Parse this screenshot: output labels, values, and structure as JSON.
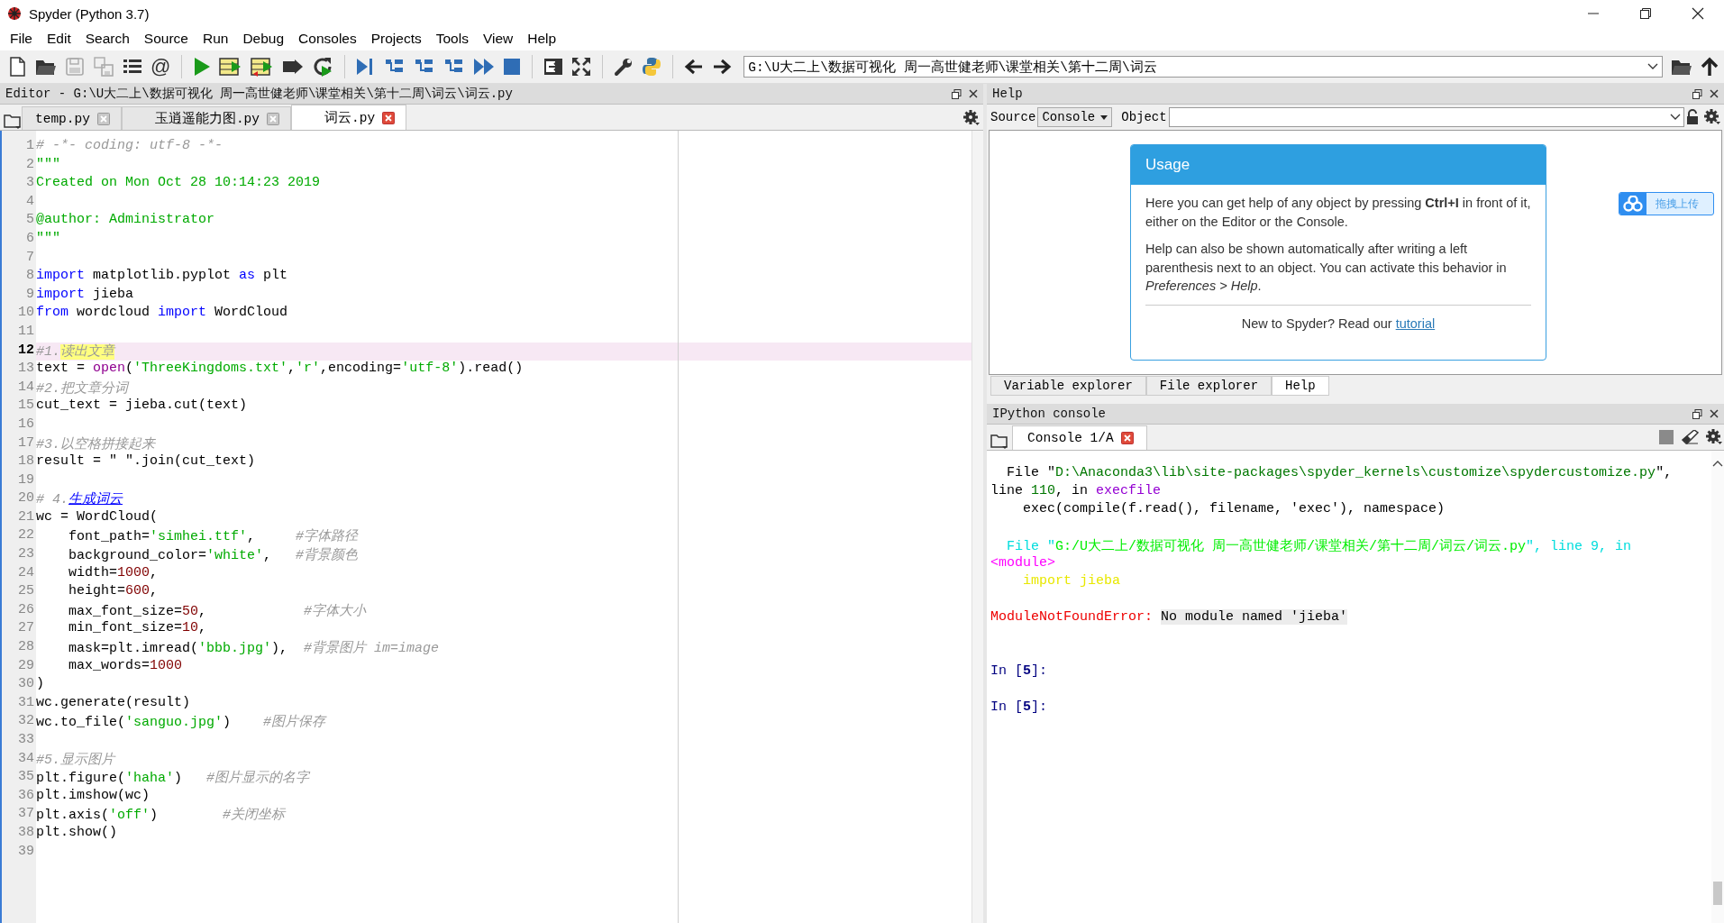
{
  "window": {
    "title": "Spyder (Python 3.7)"
  },
  "menu": [
    {
      "label": "File"
    },
    {
      "label": "Edit"
    },
    {
      "label": "Search"
    },
    {
      "label": "Source"
    },
    {
      "label": "Run"
    },
    {
      "label": "Debug"
    },
    {
      "label": "Consoles"
    },
    {
      "label": "Projects"
    },
    {
      "label": "Tools"
    },
    {
      "label": "View"
    },
    {
      "label": "Help"
    }
  ],
  "toolbar": {
    "at_symbol": "@",
    "path": "G:\\U大二上\\数据可视化 周一高世健老师\\课堂相关\\第十二周\\词云"
  },
  "editor": {
    "title": "Editor - G:\\U大二上\\数据可视化 周一高世健老师\\课堂相关\\第十二周\\词云\\词云.py",
    "tabs": [
      {
        "label": "temp.py",
        "selected": false
      },
      {
        "label": "玉逍遥能力图.py",
        "selected": false
      },
      {
        "label": "词云.py",
        "selected": true
      }
    ],
    "lines": [
      {
        "number": "1",
        "current": false,
        "tokens": [
          {
            "kind": "comment",
            "text": "# -*- coding: utf-8 -*-"
          }
        ]
      },
      {
        "number": "2",
        "current": false,
        "tokens": [
          {
            "kind": "doc",
            "text": "\"\"\""
          }
        ]
      },
      {
        "number": "3",
        "current": false,
        "tokens": [
          {
            "kind": "doc",
            "text": "Created on Mon Oct 28 10:14:23 2019"
          }
        ]
      },
      {
        "number": "4",
        "current": false
      },
      {
        "number": "5",
        "current": false,
        "tokens": [
          {
            "kind": "doc",
            "text": "@author: Administrator"
          }
        ]
      },
      {
        "number": "6",
        "current": false,
        "tokens": [
          {
            "kind": "doc",
            "text": "\"\"\""
          }
        ]
      },
      {
        "number": "7",
        "current": false
      },
      {
        "number": "8",
        "current": false,
        "tokens": [
          {
            "kind": "keyword",
            "text": "import"
          },
          {
            "kind": "plain",
            "text": " matplotlib.pyplot "
          },
          {
            "kind": "keyword",
            "text": "as"
          },
          {
            "kind": "plain",
            "text": " plt"
          }
        ]
      },
      {
        "number": "9",
        "current": false,
        "tokens": [
          {
            "kind": "keyword",
            "text": "import"
          },
          {
            "kind": "plain",
            "text": " jieba"
          }
        ]
      },
      {
        "number": "10",
        "current": false,
        "tokens": [
          {
            "kind": "keyword",
            "text": "from"
          },
          {
            "kind": "plain",
            "text": " wordcloud "
          },
          {
            "kind": "keyword",
            "text": "import"
          },
          {
            "kind": "plain",
            "text": " WordCloud"
          }
        ]
      },
      {
        "number": "11",
        "current": false
      },
      {
        "number": "12",
        "current": true,
        "tokens": [
          {
            "kind": "comment",
            "text": "#1."
          },
          {
            "kind": "mark",
            "text": "读出文章"
          }
        ]
      },
      {
        "number": "13",
        "current": false,
        "tokens": [
          {
            "kind": "plain",
            "text": "text = "
          },
          {
            "kind": "builtin",
            "text": "open"
          },
          {
            "kind": "plain",
            "text": "("
          },
          {
            "kind": "string",
            "text": "'ThreeKingdoms.txt'"
          },
          {
            "kind": "plain",
            "text": ","
          },
          {
            "kind": "string",
            "text": "'r'"
          },
          {
            "kind": "plain",
            "text": ",encoding="
          },
          {
            "kind": "string",
            "text": "'utf-8'"
          },
          {
            "kind": "plain",
            "text": ").read()"
          }
        ]
      },
      {
        "number": "14",
        "current": false,
        "tokens": [
          {
            "kind": "comment",
            "text": "#2.把文章分词"
          }
        ]
      },
      {
        "number": "15",
        "current": false,
        "tokens": [
          {
            "kind": "plain",
            "text": "cut_text = jieba.cut(text)"
          }
        ]
      },
      {
        "number": "16",
        "current": false
      },
      {
        "number": "17",
        "current": false,
        "tokens": [
          {
            "kind": "comment",
            "text": "#3.以空格拼接起来"
          }
        ]
      },
      {
        "number": "18",
        "current": false,
        "tokens": [
          {
            "kind": "plain",
            "text": "result = \" \".join(cut_text)"
          }
        ]
      },
      {
        "number": "19",
        "current": false
      },
      {
        "number": "20",
        "current": false,
        "tokens": [
          {
            "kind": "comment",
            "text": "# 4."
          },
          {
            "kind": "link",
            "text": "生成词云"
          }
        ]
      },
      {
        "number": "21",
        "current": false,
        "tokens": [
          {
            "kind": "plain",
            "text": "wc = WordCloud("
          }
        ]
      },
      {
        "number": "22",
        "current": false,
        "tokens": [
          {
            "kind": "plain",
            "text": "    font_path="
          },
          {
            "kind": "string",
            "text": "'simhei.ttf'"
          },
          {
            "kind": "plain",
            "text": ",     "
          },
          {
            "kind": "comment",
            "text": "#字体路径"
          }
        ]
      },
      {
        "number": "23",
        "current": false,
        "tokens": [
          {
            "kind": "plain",
            "text": "    background_color="
          },
          {
            "kind": "string",
            "text": "'white'"
          },
          {
            "kind": "plain",
            "text": ",   "
          },
          {
            "kind": "comment",
            "text": "#背景颜色"
          }
        ]
      },
      {
        "number": "24",
        "current": false,
        "tokens": [
          {
            "kind": "plain",
            "text": "    width="
          },
          {
            "kind": "number",
            "text": "1000"
          },
          {
            "kind": "plain",
            "text": ","
          }
        ]
      },
      {
        "number": "25",
        "current": false,
        "tokens": [
          {
            "kind": "plain",
            "text": "    height="
          },
          {
            "kind": "number",
            "text": "600"
          },
          {
            "kind": "plain",
            "text": ","
          }
        ]
      },
      {
        "number": "26",
        "current": false,
        "tokens": [
          {
            "kind": "plain",
            "text": "    max_font_size="
          },
          {
            "kind": "number",
            "text": "50"
          },
          {
            "kind": "plain",
            "text": ",            "
          },
          {
            "kind": "comment",
            "text": "#字体大小"
          }
        ]
      },
      {
        "number": "27",
        "current": false,
        "tokens": [
          {
            "kind": "plain",
            "text": "    min_font_size="
          },
          {
            "kind": "number",
            "text": "10"
          },
          {
            "kind": "plain",
            "text": ","
          }
        ]
      },
      {
        "number": "28",
        "current": false,
        "tokens": [
          {
            "kind": "plain",
            "text": "    mask=plt.imread("
          },
          {
            "kind": "string",
            "text": "'bbb.jpg'"
          },
          {
            "kind": "plain",
            "text": "),  "
          },
          {
            "kind": "comment",
            "text": "#背景图片 im=image"
          }
        ]
      },
      {
        "number": "29",
        "current": false,
        "tokens": [
          {
            "kind": "plain",
            "text": "    max_words="
          },
          {
            "kind": "number",
            "text": "1000"
          }
        ]
      },
      {
        "number": "30",
        "current": false,
        "tokens": [
          {
            "kind": "plain",
            "text": ")"
          }
        ]
      },
      {
        "number": "31",
        "current": false,
        "tokens": [
          {
            "kind": "plain",
            "text": "wc.generate(result)"
          }
        ]
      },
      {
        "number": "32",
        "current": false,
        "tokens": [
          {
            "kind": "plain",
            "text": "wc.to_file("
          },
          {
            "kind": "string",
            "text": "'sanguo.jpg'"
          },
          {
            "kind": "plain",
            "text": ")    "
          },
          {
            "kind": "comment",
            "text": "#图片保存"
          }
        ]
      },
      {
        "number": "33",
        "current": false
      },
      {
        "number": "34",
        "current": false,
        "tokens": [
          {
            "kind": "comment",
            "text": "#5.显示图片"
          }
        ]
      },
      {
        "number": "35",
        "current": false,
        "tokens": [
          {
            "kind": "plain",
            "text": "plt.figure("
          },
          {
            "kind": "string",
            "text": "'haha'"
          },
          {
            "kind": "plain",
            "text": ")   "
          },
          {
            "kind": "comment",
            "text": "#图片显示的名字"
          }
        ]
      },
      {
        "number": "36",
        "current": false,
        "tokens": [
          {
            "kind": "plain",
            "text": "plt.imshow(wc)"
          }
        ]
      },
      {
        "number": "37",
        "current": false,
        "tokens": [
          {
            "kind": "plain",
            "text": "plt.axis("
          },
          {
            "kind": "string",
            "text": "'off'"
          },
          {
            "kind": "plain",
            "text": ")        "
          },
          {
            "kind": "comment",
            "text": "#关闭坐标"
          }
        ]
      },
      {
        "number": "38",
        "current": false,
        "tokens": [
          {
            "kind": "plain",
            "text": "plt.show()"
          }
        ]
      },
      {
        "number": "39",
        "current": false
      }
    ]
  },
  "help": {
    "title": "Help",
    "source_label": "Source",
    "source_value": "Console",
    "object_label": "Object",
    "usage": {
      "title": "Usage",
      "paragraphs": [
        "Here you can get help of any object by pressing **Ctrl+I** in front of it, either on the Editor or the Console.",
        "Help can also be shown automatically after writing a left parenthesis next to an object. You can activate this behavior in *Preferences > Help*."
      ],
      "footer": "New to Spyder? Read our",
      "link": "tutorial"
    },
    "upload_button": "拖拽上传"
  },
  "pane_tabs": [
    {
      "label": "Variable explorer",
      "selected": false
    },
    {
      "label": "File explorer",
      "selected": false
    },
    {
      "label": "Help",
      "selected": true
    }
  ],
  "console": {
    "title": "IPython console",
    "tabs": [
      {
        "label": "Console 1/A",
        "selected": true
      }
    ],
    "lines": [
      {
        "kind": "text",
        "tokens": [
          {
            "kind": "plain",
            "text": "  File \""
          },
          {
            "kind": "path",
            "text": "D:\\Anaconda3\\lib\\site-packages\\spyder_kernels\\customize\\spydercustomize.py"
          },
          {
            "kind": "plain",
            "text": "\","
          }
        ]
      },
      {
        "kind": "text",
        "tokens": [
          {
            "kind": "plain",
            "text": "line "
          },
          {
            "kind": "path",
            "text": "110"
          },
          {
            "kind": "plain",
            "text": ", in "
          },
          {
            "kind": "func",
            "text": "execfile"
          }
        ]
      },
      {
        "kind": "text",
        "tokens": [
          {
            "kind": "plain",
            "text": "    exec(compile(f.read(), filename, 'exec'), namespace)"
          }
        ]
      },
      {
        "kind": "blank"
      },
      {
        "kind": "text",
        "tokens": [
          {
            "kind": "cyan",
            "text": "  File \""
          },
          {
            "kind": "green",
            "text": "G:/U大二上/数据可视化 周一高世健老师/课堂相关/第十二周/词云/词云.py"
          },
          {
            "kind": "cyan",
            "text": "\", line 9, in"
          }
        ]
      },
      {
        "kind": "text",
        "tokens": [
          {
            "kind": "magenta",
            "text": "<module>"
          }
        ]
      },
      {
        "kind": "text",
        "tokens": [
          {
            "kind": "yellow",
            "text": "    import jieba"
          }
        ]
      },
      {
        "kind": "blank"
      },
      {
        "kind": "text",
        "tokens": [
          {
            "kind": "error",
            "text": "ModuleNotFoundError: "
          },
          {
            "kind": "message",
            "text": "No module named 'jieba'"
          }
        ]
      },
      {
        "kind": "blank"
      },
      {
        "kind": "blank"
      },
      {
        "kind": "text",
        "tokens": [
          {
            "kind": "prompt",
            "text": "In ["
          },
          {
            "kind": "prompt-num",
            "text": "5"
          },
          {
            "kind": "prompt",
            "text": "]:"
          }
        ]
      },
      {
        "kind": "blank"
      },
      {
        "kind": "text",
        "tokens": [
          {
            "kind": "prompt",
            "text": "In ["
          },
          {
            "kind": "prompt-num",
            "text": "5"
          },
          {
            "kind": "prompt",
            "text": "]:"
          }
        ]
      }
    ]
  }
}
